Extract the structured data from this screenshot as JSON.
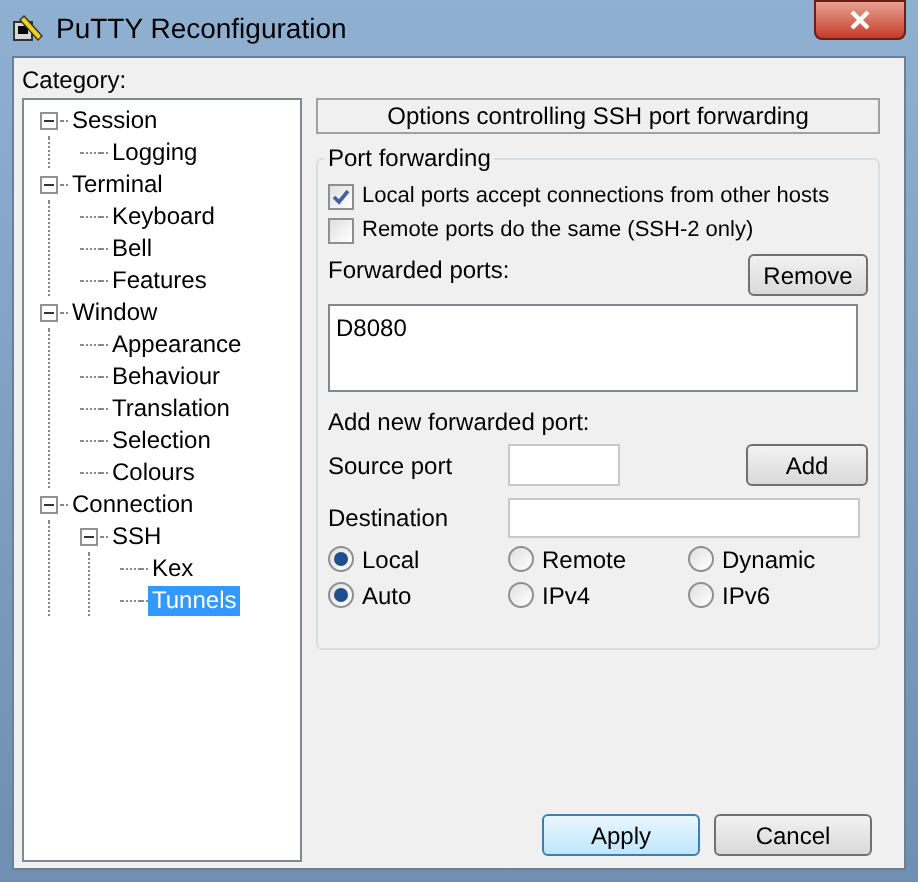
{
  "window": {
    "title": "PuTTY Reconfiguration"
  },
  "category": {
    "label": "Category:",
    "tree": [
      {
        "label": "Session",
        "expanded": true,
        "selected": false,
        "children": [
          {
            "label": "Logging",
            "selected": false
          }
        ]
      },
      {
        "label": "Terminal",
        "expanded": true,
        "selected": false,
        "children": [
          {
            "label": "Keyboard",
            "selected": false
          },
          {
            "label": "Bell",
            "selected": false
          },
          {
            "label": "Features",
            "selected": false
          }
        ]
      },
      {
        "label": "Window",
        "expanded": true,
        "selected": false,
        "children": [
          {
            "label": "Appearance",
            "selected": false
          },
          {
            "label": "Behaviour",
            "selected": false
          },
          {
            "label": "Translation",
            "selected": false
          },
          {
            "label": "Selection",
            "selected": false
          },
          {
            "label": "Colours",
            "selected": false
          }
        ]
      },
      {
        "label": "Connection",
        "expanded": true,
        "selected": false,
        "children": [
          {
            "label": "SSH",
            "expanded": true,
            "selected": false,
            "children": [
              {
                "label": "Kex",
                "selected": false
              },
              {
                "label": "Tunnels",
                "selected": true
              }
            ]
          }
        ]
      }
    ]
  },
  "panel": {
    "header": "Options controlling SSH port forwarding",
    "group": {
      "title": "Port forwarding",
      "checkboxes": [
        {
          "label": "Local ports accept connections from other hosts",
          "checked": true
        },
        {
          "label": "Remote ports do the same (SSH-2 only)",
          "checked": false
        }
      ],
      "forwarded_ports": {
        "label": "Forwarded ports:",
        "remove_button": "Remove",
        "items": [
          "D8080"
        ]
      },
      "add_label": "Add new forwarded port:",
      "source_port": {
        "label": "Source port"
      },
      "add_button": "Add",
      "destination": {
        "label": "Destination"
      },
      "radio_rows": [
        {
          "options": [
            {
              "label": "Local",
              "selected": true
            },
            {
              "label": "Remote",
              "selected": false
            },
            {
              "label": "Dynamic",
              "selected": false
            }
          ]
        },
        {
          "options": [
            {
              "label": "Auto",
              "selected": true
            },
            {
              "label": "IPv4",
              "selected": false
            },
            {
              "label": "IPv6",
              "selected": false
            }
          ]
        }
      ]
    }
  },
  "buttons": [
    {
      "label": "Apply",
      "default": true
    },
    {
      "label": "Cancel",
      "default": false
    }
  ]
}
